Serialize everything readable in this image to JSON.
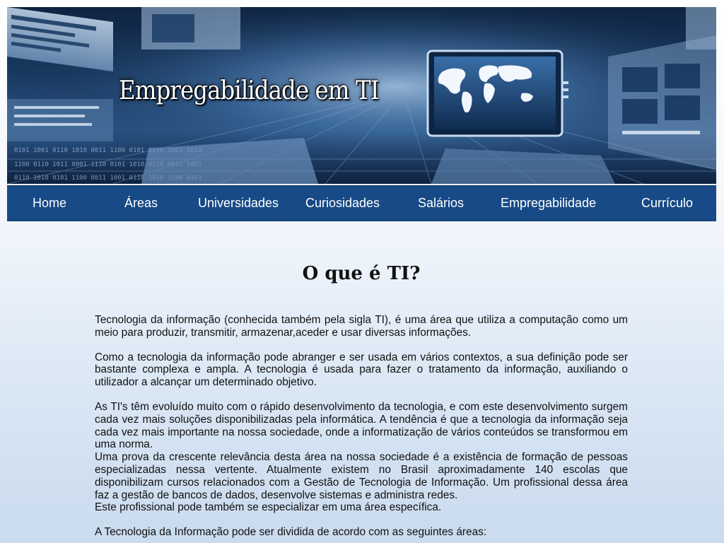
{
  "banner": {
    "title": "Empregabilidade em TI"
  },
  "nav": {
    "items": [
      {
        "label": "Home"
      },
      {
        "label": "Áreas"
      },
      {
        "label": "Universidades"
      },
      {
        "label": "Curiosidades"
      },
      {
        "label": "Salários"
      },
      {
        "label": "Empregabilidade"
      },
      {
        "label": "Currículo"
      }
    ]
  },
  "main": {
    "title": "O que é TI?",
    "paragraphs": [
      "Tecnologia da informação (conhecida também pela sigla TI), é uma área que utiliza a computação como um meio para produzir, transmitir, armazenar,aceder e usar diversas informações.",
      "Como a tecnologia da informação pode abranger e ser usada em vários contextos, a sua definição pode ser bastante complexa e ampla. A tecnologia é usada para fazer o tratamento da informação, auxiliando o utilizador a alcançar um determinado objetivo.",
      "As TI's têm evoluído muito com o rápido desenvolvimento da tecnologia, e com este desenvolvimento surgem cada vez mais soluções disponibilizadas pela informática. A tendência é que a tecnologia da informação seja cada vez mais importante na nossa sociedade, onde a informatização de vários conteúdos se transformou em uma norma.",
      "Uma prova da crescente relevância desta área na nossa sociedade é a existência de formação de pessoas especializadas nessa vertente. Atualmente existem no Brasil aproximadamente 140 escolas que disponibilizam cursos relacionados com a Gestão de Tecnologia de Informação. Um profissional dessa área faz a gestão de bancos de dados, desenvolve sistemas e administra redes.",
      "Este profissional pode também se especializar em uma área específica.",
      "A Tecnologia da Informação pode ser dividida de acordo com as seguintes áreas:"
    ]
  },
  "colors": {
    "nav_background": "#174a86",
    "banner_background": "#1b3b63",
    "text": "#111111"
  }
}
